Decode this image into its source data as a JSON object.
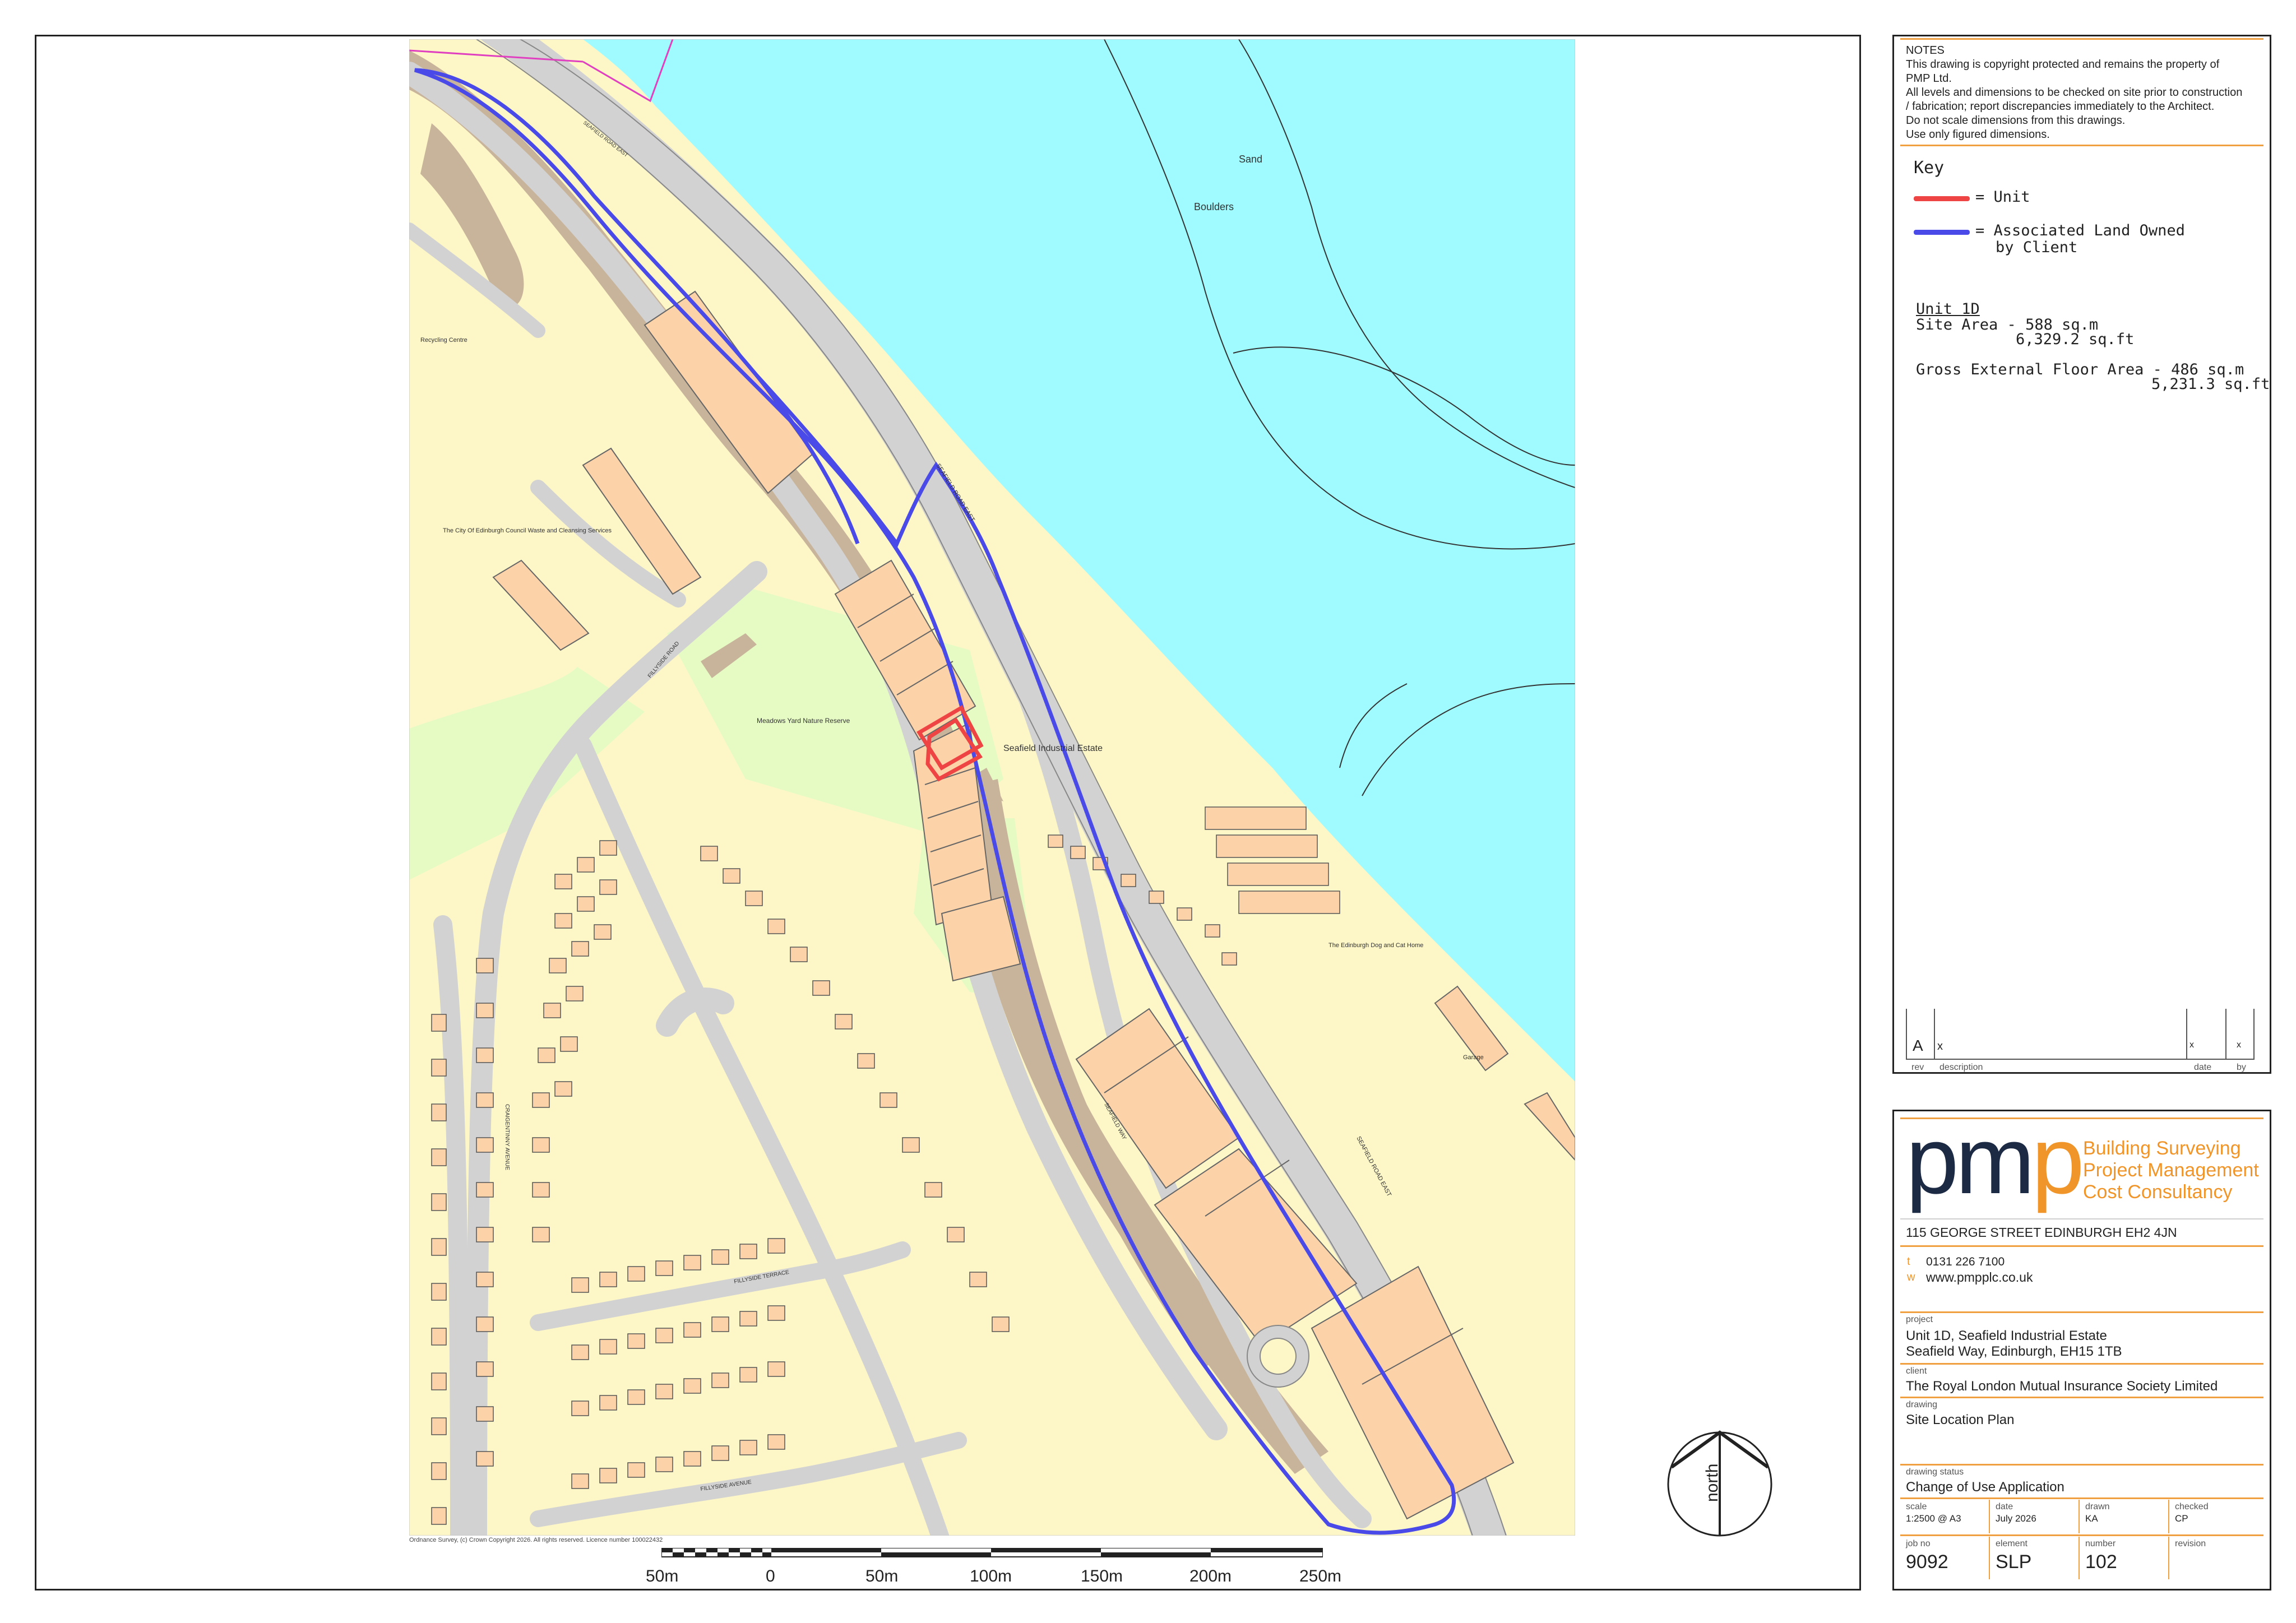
{
  "notes": {
    "heading": "NOTES",
    "lines": [
      "This drawing is copyright protected and remains the property of",
      "PMP Ltd.",
      "All levels and dimensions to be checked on site prior to construction",
      "/ fabrication; report discrepancies immediately to the Architect.",
      "Do not scale dimensions from this drawings.",
      "Use only figured dimensions."
    ]
  },
  "key": {
    "heading": "Key",
    "unit_label": "= Unit",
    "land_label_1": "= Associated Land Owned",
    "land_label_2": "by Client",
    "unit_color": "#ee4444",
    "land_color": "#4a4ae8"
  },
  "areas": {
    "unit_title": "Unit 1D",
    "site_area_label": "Site Area - 588 sq.m",
    "site_area_ft": "6,329.2 sq.ft",
    "gefa_label": "Gross External Floor Area - 486 sq.m",
    "gefa_ft": "5,231.3 sq.ft"
  },
  "revisions": {
    "rev": "A",
    "description": "x",
    "date": "x",
    "by": "x",
    "col_rev": "rev",
    "col_description": "description",
    "col_date": "date",
    "col_by": "by"
  },
  "company": {
    "logo_text": "pmp",
    "logo_p_color": "#f0952a",
    "logo_main_color": "#1c2a44",
    "services": [
      "Building Surveying",
      "Project Management",
      "Cost Consultancy"
    ],
    "address": "115 GEORGE STREET  EDINBURGH  EH2 4JN",
    "tel_prefix": "t",
    "tel": "0131 226 7100",
    "web_prefix": "w",
    "web": "www.pmpplc.co.uk"
  },
  "titleblock": {
    "project_label": "project",
    "project_line1": "Unit 1D, Seafield Industrial Estate",
    "project_line2": "Seafield Way, Edinburgh, EH15 1TB",
    "client_label": "client",
    "client": "The Royal London Mutual Insurance Society Limited",
    "drawing_label": "drawing",
    "drawing": "Site Location Plan",
    "status_label": "drawing status",
    "status": "Change of Use Application",
    "scale_label": "scale",
    "scale": "1:2500 @ A3",
    "date_label": "date",
    "date": "July 2026",
    "drawn_label": "drawn",
    "drawn": "KA",
    "checked_label": "checked",
    "checked": "CP",
    "jobno_label": "job no",
    "jobno": "9092",
    "element_label": "element",
    "element": "SLP",
    "number_label": "number",
    "number": "102",
    "revision_label": "revision",
    "revision": ""
  },
  "map": {
    "copyright": "Ordnance Survey, (c) Crown Copyright 2026. All rights reserved. Licence number 100022432",
    "north_label": "north",
    "scale_ticks": [
      "50m",
      "0",
      "50m",
      "100m",
      "150m",
      "200m",
      "250m"
    ],
    "labels": {
      "sand": "Sand",
      "boulders": "Boulders",
      "seafield_road_east": "SEAFIELD ROAD EAST",
      "seafield_estate": "Seafield Industrial Estate",
      "meadows_yard": "Meadows Yard Nature Reserve",
      "council": "The City Of Edinburgh Council Waste and Cleansing Services",
      "recycling": "Recycling Centre",
      "dog_cat_home": "The Edinburgh Dog and Cat Home",
      "garage": "Garage",
      "fillyside_terrace": "FILLYSIDE TERRACE",
      "fillyside_avenue": "FILLYSIDE AVENUE",
      "craigentinny_avenue": "CRAIGENTINNY AVENUE",
      "fillyside_road": "FILLYSIDE ROAD",
      "seafield_way": "SEAFIELD WAY"
    }
  }
}
